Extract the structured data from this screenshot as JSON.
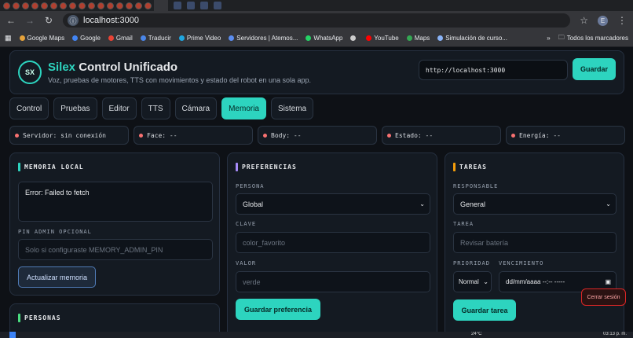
{
  "browser": {
    "url": "localhost:3000",
    "bookmarks": [
      {
        "label": "Google Maps",
        "color": "#e5a23b"
      },
      {
        "label": "Google",
        "color": "#4285f4"
      },
      {
        "label": "Gmail",
        "color": "#ea4335"
      },
      {
        "label": "Traducir",
        "color": "#4a86e8"
      },
      {
        "label": "Prime Video",
        "color": "#1fa6e0"
      },
      {
        "label": "Servidores | Atemos...",
        "color": "#5b8def"
      },
      {
        "label": "WhatsApp",
        "color": "#25d366"
      },
      {
        "label": "",
        "color": "#cccccc"
      },
      {
        "label": "YouTube",
        "color": "#ff0000"
      },
      {
        "label": "Maps",
        "color": "#34a853"
      },
      {
        "label": "Simulación de curso...",
        "color": "#8ab4f8"
      }
    ],
    "more": "»",
    "all_bookmarks": "Todos los marcadores",
    "profile_initial": "E"
  },
  "app": {
    "logo": "SX",
    "title_accent": "Silex",
    "title_rest": " Control Unificado",
    "subtitle": "Voz, pruebas de motores, TTS con movimientos y estado del robot en una sola app.",
    "server_url": "http://localhost:3000",
    "save_label": "Guardar",
    "tabs": [
      "Control",
      "Pruebas",
      "Editor",
      "TTS",
      "Cámara",
      "Memoria",
      "Sistema"
    ],
    "active_tab": "Memoria",
    "status": [
      "Servidor: sin conexión",
      "Face: --",
      "Body: --",
      "Estado: --",
      "Energía: --"
    ],
    "status_color": "#f87171"
  },
  "memory": {
    "heading": "MEMORIA LOCAL",
    "error": "Error: Failed to fetch",
    "pin_label": "PIN ADMIN OPCIONAL",
    "pin_placeholder": "Solo si configuraste MEMORY_ADMIN_PIN",
    "refresh_label": "Actualizar memoria",
    "people_heading": "PERSONAS",
    "accent": "#2dd4bf"
  },
  "prefs": {
    "heading": "PREFERENCIAS",
    "person_label": "PERSONA",
    "person_value": "Global",
    "key_label": "CLAVE",
    "key_placeholder": "color_favorito",
    "value_label": "VALOR",
    "value_placeholder": "verde",
    "save_label": "Guardar preferencia",
    "accent": "#a78bfa"
  },
  "tasks": {
    "heading": "TAREAS",
    "owner_label": "RESPONSABLE",
    "owner_value": "General",
    "task_label": "TAREA",
    "task_placeholder": "Revisar batería",
    "priority_label": "PRIORIDAD",
    "priority_value": "Normal",
    "due_label": "VENCIMIENTO",
    "due_placeholder": "dd/mm/aaaa --:-- -----",
    "save_label": "Guardar tarea",
    "accent": "#f59e0b"
  },
  "toast": "Cerrar sesión",
  "taskbar": {
    "weather": "24°C",
    "time": "03:13 p. m."
  }
}
